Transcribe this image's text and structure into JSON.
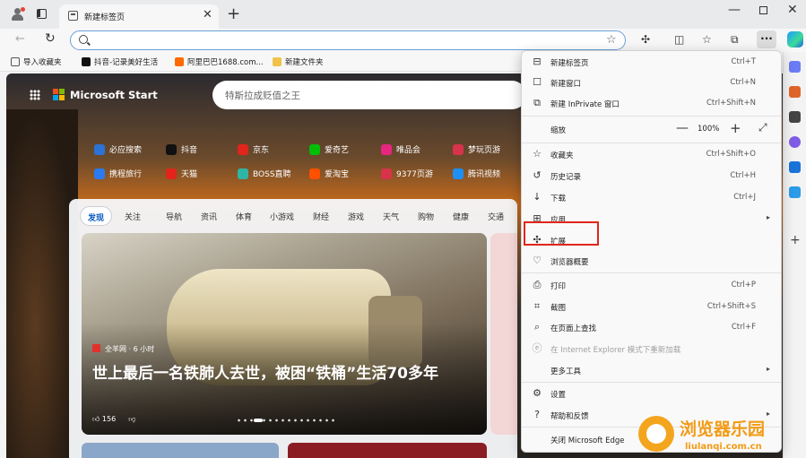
{
  "tab": {
    "title": "新建标签页"
  },
  "address": {
    "value": "",
    "placeholder": ""
  },
  "bookmarks": [
    {
      "label": "导入收藏夹",
      "color": "#555555"
    },
    {
      "label": "抖音-记录美好生活",
      "color": "#111111"
    },
    {
      "label": "阿里巴巴1688.com...",
      "color": "#ff6a00"
    },
    {
      "label": "新建文件夹",
      "color": "#f0c24a"
    }
  ],
  "newtab": {
    "brand": "Microsoft Start",
    "search_text": "特斯拉成贬值之王",
    "quick_links": [
      {
        "label": "必应搜索",
        "color": "#2b73d6"
      },
      {
        "label": "抖音",
        "color": "#111111"
      },
      {
        "label": "京东",
        "color": "#e1251b"
      },
      {
        "label": "爱奇艺",
        "color": "#00be06"
      },
      {
        "label": "唯品会",
        "color": "#e6267f"
      },
      {
        "label": "梦玩页游",
        "color": "#d8334a"
      },
      {
        "label": "携程旅行",
        "color": "#2a7bf0"
      },
      {
        "label": "天猫",
        "color": "#e1251b"
      },
      {
        "label": "BOSS直聘",
        "color": "#2fb5a6"
      },
      {
        "label": "爱淘宝",
        "color": "#ff5000"
      },
      {
        "label": "9377页游",
        "color": "#d8334a"
      },
      {
        "label": "腾讯视频",
        "color": "#1e8ff5"
      }
    ],
    "feed_tabs": [
      "发现",
      "关注",
      "导航",
      "资讯",
      "体育",
      "小游戏",
      "财经",
      "游戏",
      "天气",
      "购物",
      "健康",
      "交通"
    ],
    "hero": {
      "source": "全羊网 · 6 小时",
      "title": "世上最后一名铁肺人去世，被困“铁桶”生活70多年",
      "likes": "156"
    }
  },
  "menu": {
    "items": [
      {
        "icon": "new-tab-icon",
        "glyph": "⊟",
        "label": "新建标签页",
        "shortcut": "Ctrl+T"
      },
      {
        "icon": "new-window-icon",
        "glyph": "☐",
        "label": "新建窗口",
        "shortcut": "Ctrl+N"
      },
      {
        "icon": "inprivate-icon",
        "glyph": "⧉",
        "label": "新建 InPrivate 窗口",
        "shortcut": "Ctrl+Shift+N"
      },
      {
        "icon": "favorites-icon",
        "glyph": "☆",
        "label": "收藏夹",
        "shortcut": "Ctrl+Shift+O"
      },
      {
        "icon": "history-icon",
        "glyph": "↺",
        "label": "历史记录",
        "shortcut": "Ctrl+H"
      },
      {
        "icon": "download-icon",
        "glyph": "↓",
        "label": "下载",
        "shortcut": "Ctrl+J"
      },
      {
        "icon": "apps-icon",
        "glyph": "⊞",
        "label": "应用",
        "shortcut": ""
      },
      {
        "icon": "extensions-icon",
        "glyph": "✣",
        "label": "扩展",
        "shortcut": ""
      },
      {
        "icon": "browser-essentials-icon",
        "glyph": "♡",
        "label": "浏览器概要",
        "shortcut": ""
      },
      {
        "icon": "print-icon",
        "glyph": "⎙",
        "label": "打印",
        "shortcut": "Ctrl+P"
      },
      {
        "icon": "screenshot-icon",
        "glyph": "⌗",
        "label": "截图",
        "shortcut": "Ctrl+Shift+S"
      },
      {
        "icon": "find-icon",
        "glyph": "⌕",
        "label": "在页面上查找",
        "shortcut": "Ctrl+F"
      },
      {
        "icon": "ie-mode-icon",
        "glyph": "ⓔ",
        "label": "在 Internet Explorer 模式下重新加载",
        "shortcut": ""
      },
      {
        "icon": "",
        "glyph": "",
        "label": "更多工具",
        "shortcut": ""
      },
      {
        "icon": "settings-icon",
        "glyph": "⚙",
        "label": "设置",
        "shortcut": ""
      },
      {
        "icon": "help-icon",
        "glyph": "?",
        "label": "帮助和反馈",
        "shortcut": ""
      },
      {
        "icon": "",
        "glyph": "",
        "label": "关闭 Microsoft Edge",
        "shortcut": ""
      }
    ],
    "zoom_label": "缩放",
    "zoom_value": "100%"
  },
  "watermark": {
    "cn": "浏览器乐园",
    "en": "liulanqi.com.cn"
  }
}
